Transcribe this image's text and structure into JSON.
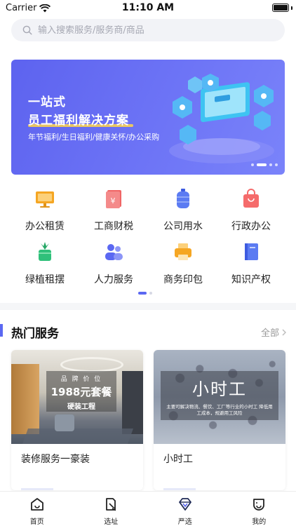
{
  "status_bar": {
    "carrier": "Carrier",
    "time": "11:10 AM"
  },
  "search": {
    "placeholder": "输入搜索服务/服务商/商品"
  },
  "banner": {
    "title": "一站式",
    "subtitle": "员工福利解决方案",
    "description": "年节福利/生日福利/健康关怀/办公采购",
    "pages": 4,
    "active_page": 2
  },
  "categories": [
    {
      "label": "办公租赁",
      "icon": "monitor-icon",
      "color": "#f5a623"
    },
    {
      "label": "工商财税",
      "icon": "tax-receipt-icon",
      "color": "#f06565"
    },
    {
      "label": "公司用水",
      "icon": "water-bucket-icon",
      "color": "#5b7bf2"
    },
    {
      "label": "行政办公",
      "icon": "shopping-bag-icon",
      "color": "#f56b6b"
    },
    {
      "label": "绿植租摆",
      "icon": "potted-plant-icon",
      "color": "#2fc07a"
    },
    {
      "label": "人力服务",
      "icon": "people-icon",
      "color": "#5b68f2"
    },
    {
      "label": "商务印包",
      "icon": "printer-icon",
      "color": "#f5a623"
    },
    {
      "label": "知识产权",
      "icon": "book-icon",
      "color": "#5b7bf2"
    }
  ],
  "hot_services": {
    "title": "热门服务",
    "see_all": "全部",
    "cards": [
      {
        "label": "装修服务一豪装",
        "img_small": "品 牌 价 位",
        "img_big": "1988元套餐",
        "img_sub": "硬装工程"
      },
      {
        "label": "小时工",
        "img_big": "小时工",
        "img_desc": "主要可解决物流、餐饮、工厂等行业的小时工 降低用工成本，规避用工风险"
      }
    ]
  },
  "tabbar": [
    {
      "label": "首页",
      "icon": "home-icon"
    },
    {
      "label": "选址",
      "icon": "location-select-icon"
    },
    {
      "label": "严选",
      "icon": "diamond-icon"
    },
    {
      "label": "我的",
      "icon": "profile-face-icon"
    }
  ],
  "colors": {
    "accent": "#5b68f2",
    "banner": "#6369f2"
  }
}
